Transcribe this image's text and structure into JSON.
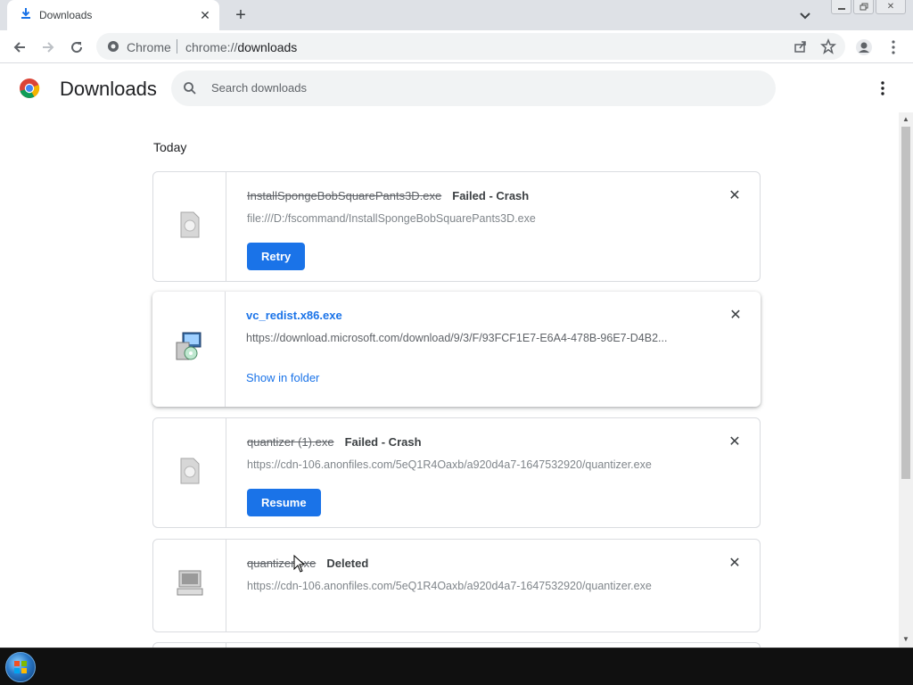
{
  "browser": {
    "tab": {
      "title": "Downloads"
    },
    "omnibox": {
      "site_label": "Chrome",
      "url_prefix": "chrome://",
      "url_path": "downloads"
    }
  },
  "page": {
    "title": "Downloads",
    "search": {
      "placeholder": "Search downloads"
    },
    "section_label": "Today",
    "items": [
      {
        "filename": "InstallSpongeBobSquarePants3D.exe",
        "status": "Failed - Crash",
        "url": "file:///D:/fscommand/InstallSpongeBobSquarePants3D.exe",
        "action": "Retry",
        "icon": "generic-file-icon"
      },
      {
        "filename": "vc_redist.x86.exe",
        "status": "",
        "url": "https://download.microsoft.com/download/9/3/F/93FCF1E7-E6A4-478B-96E7-D4B2...",
        "action": "Show in folder",
        "icon": "installer-icon"
      },
      {
        "filename": "quantizer (1).exe",
        "status": "Failed - Crash",
        "url": "https://cdn-106.anonfiles.com/5eQ1R4Oaxb/a920d4a7-1647532920/quantizer.exe",
        "action": "Resume",
        "icon": "generic-file-icon"
      },
      {
        "filename": "quantizer.exe",
        "status": "Deleted",
        "url": "https://cdn-106.anonfiles.com/5eQ1R4Oaxb/a920d4a7-1647532920/quantizer.exe",
        "action": "",
        "icon": "application-icon"
      }
    ]
  },
  "colors": {
    "accent": "#1a73e8",
    "tabstrip": "#dee1e6",
    "taskbar": "#101010"
  }
}
